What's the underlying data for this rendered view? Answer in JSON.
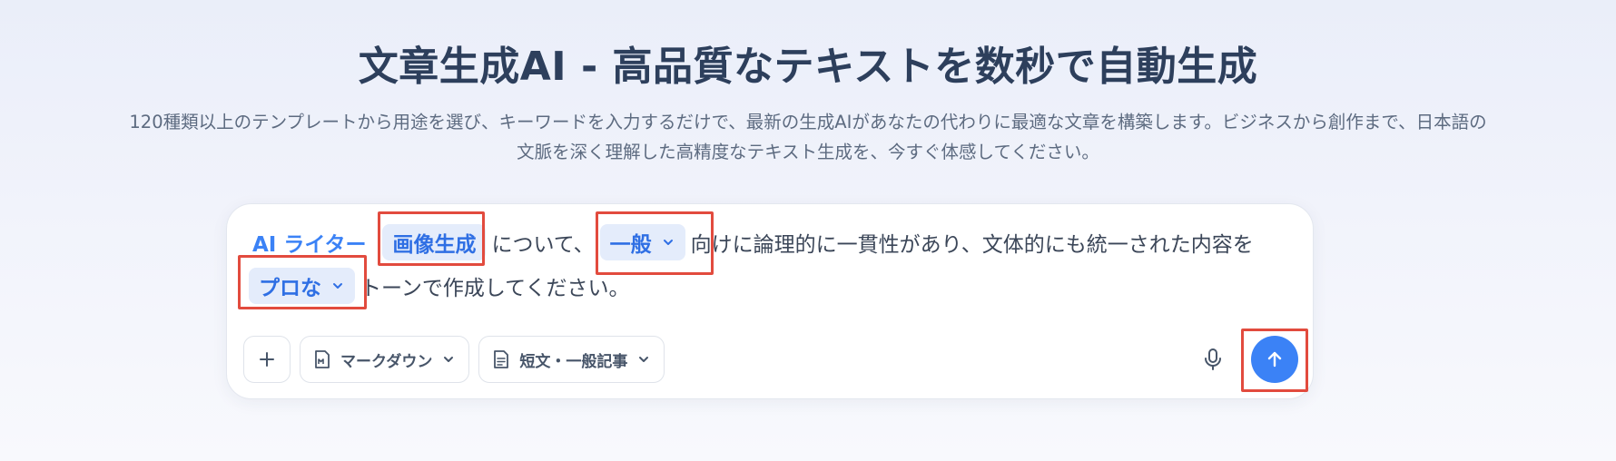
{
  "hero": {
    "title": "文章生成AI - 高品質なテキストを数秒で自動生成",
    "subtitle_line1": "120種類以上のテンプレートから用途を選び、キーワードを入力するだけで、最新の生成AIがあなたの代わりに最適な文章を構築します。ビジネスから創作まで、日本語の",
    "subtitle_line2": "文脈を深く理解した高精度なテキスト生成を、今すぐ体感してください。"
  },
  "prompt": {
    "brand": "AI ライター",
    "topic_chip": "画像生成",
    "text_after_topic": "について、",
    "audience_chip": "一般",
    "text_after_audience": "向けに論理的に一貫性があり、文体的にも統一された内容を",
    "tone_chip": "プロな",
    "text_after_tone": "トーンで作成してください。"
  },
  "toolbar": {
    "format_label": "マークダウン",
    "length_label": "短文・一般記事"
  },
  "icons": {
    "add": "plus-icon",
    "format": "markdown-icon",
    "length": "document-icon",
    "mic": "microphone-icon",
    "send": "arrow-up-icon"
  },
  "colors": {
    "accent": "#3b82f6",
    "chip_bg": "#e4ecfb",
    "highlight": "#e24b3e",
    "title": "#2d3f5c"
  }
}
